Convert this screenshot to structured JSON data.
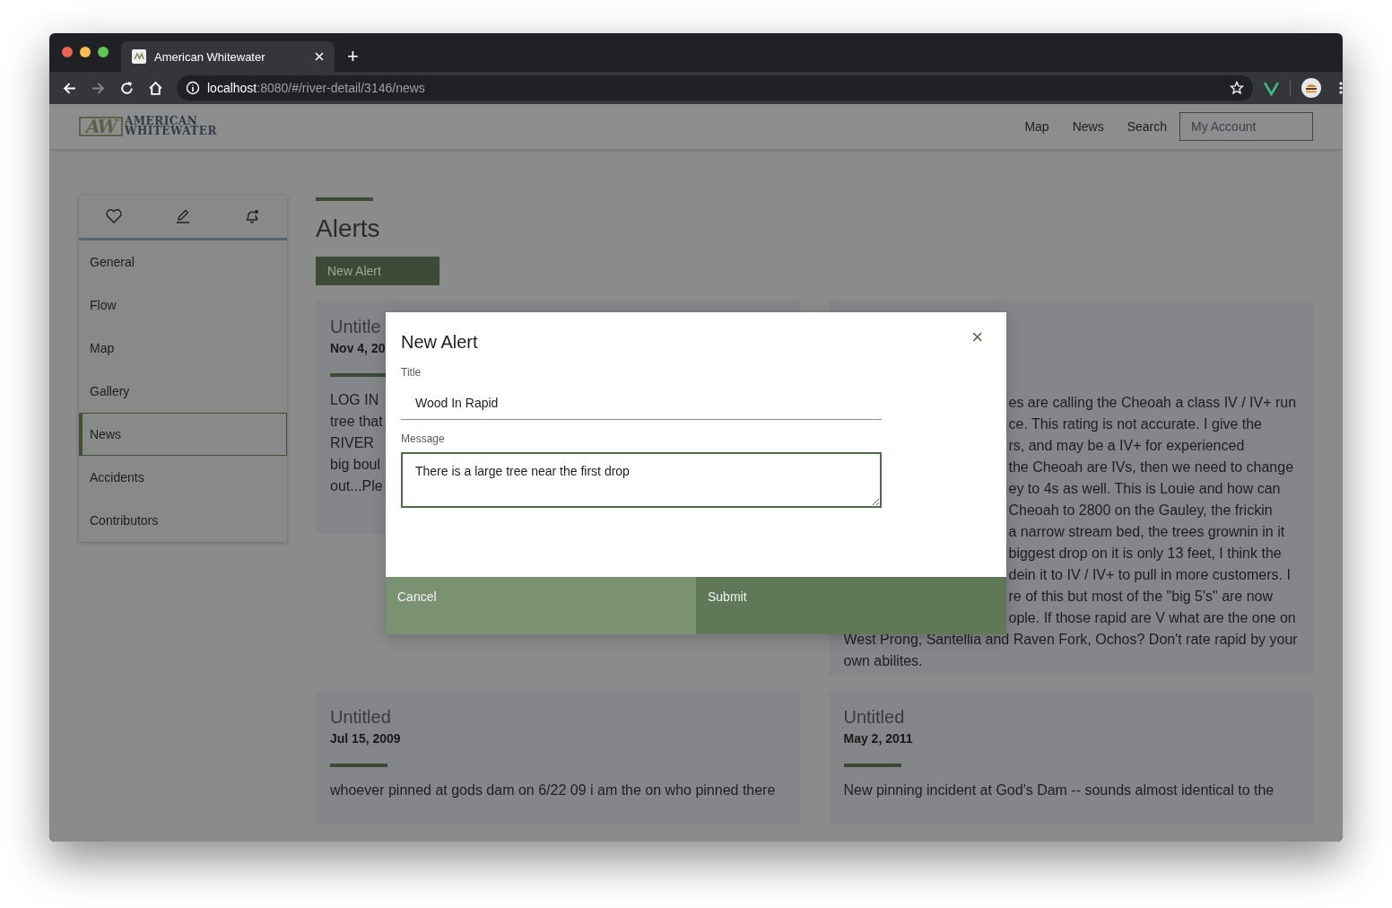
{
  "browser": {
    "tab_title": "American Whitewater",
    "new_tab": "+",
    "url_host": "localhost",
    "url_path": ":8080/#/river-detail/3146/news"
  },
  "header": {
    "logo": {
      "mark": "AW",
      "line1": "AMERICAN",
      "line2": "WHITEWATER"
    },
    "nav": [
      {
        "label": "Map"
      },
      {
        "label": "News"
      },
      {
        "label": "Search"
      }
    ],
    "account_button": "My Account"
  },
  "sidebar": {
    "items": [
      {
        "label": "General",
        "selected": false
      },
      {
        "label": "Flow",
        "selected": false
      },
      {
        "label": "Map",
        "selected": false
      },
      {
        "label": "Gallery",
        "selected": false
      },
      {
        "label": "News",
        "selected": true
      },
      {
        "label": "Accidents",
        "selected": false
      },
      {
        "label": "Contributors",
        "selected": false
      }
    ]
  },
  "section": {
    "title": "Alerts",
    "new_button": "New Alert"
  },
  "cards": [
    {
      "title": "Untitle",
      "date": "Nov 4, 20",
      "lines": [
        "LOG IN",
        "tree that",
        "RIVER",
        "big boul",
        "out...Ple"
      ]
    },
    {
      "covered_lines": [
        "es are calling the Cheoah a class IV / IV+ run",
        "ce. This rating is not accurate. I give the",
        "rs, and may be a IV+ for experienced",
        "the Cheoah are IVs, then we need to change",
        "ey to 4s as well. This is Louie and how can",
        "Cheoah to 2800 on the Gauley, the frickin",
        "a narrow stream bed, the trees grownin in it",
        "biggest drop on it is only 13 feet, I think the",
        "dein it to IV / IV+ to pull in more customers. I",
        "re of this but most of the \"big 5's\" are now",
        "ople. If those rapid are V what are the one on"
      ],
      "lines": [
        "West Prong, Santellia and Raven Fork, Ochos? Don't rate rapid by your",
        "own abilites."
      ]
    },
    {
      "title": "Untitled",
      "date": "Jul 15, 2009",
      "lines": [
        "whoever pinned at gods dam on 6/22 09 i am the on who pinned there"
      ]
    },
    {
      "title": "Untitled",
      "date": "May 2, 2011",
      "lines": [
        "New pinning incident at God's Dam -- sounds almost identical to the"
      ]
    }
  ],
  "modal": {
    "title": "New Alert",
    "close": "×",
    "title_label": "Title",
    "title_value": "Wood In Rapid",
    "message_label": "Message",
    "message_value": "There is a large tree near the first drop",
    "cancel": "Cancel",
    "submit": "Submit"
  }
}
